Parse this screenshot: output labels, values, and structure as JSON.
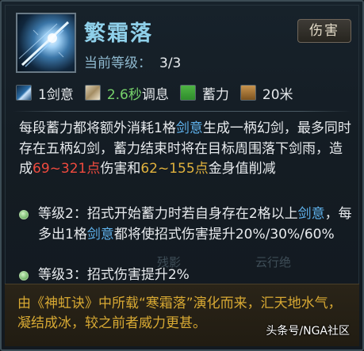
{
  "skill": {
    "name": "繁霜落",
    "level_label": "当前等级：",
    "level_value": "3/3",
    "type_badge": "伤害"
  },
  "stats": {
    "cost": "1剑意",
    "cooldown": "2.6秒",
    "cooldown_suffix": "调息",
    "cast": "蓄力",
    "range": "20米"
  },
  "description": {
    "p1": "每段蓄力都将额外消耗1格",
    "kw1": "剑意",
    "p2": "生成一柄幻剑，最多同时存在五柄幻剑，蓄力结束时将在目标周围落下剑雨，造成",
    "dmg_min": "69",
    "dmg_sep1": "~",
    "dmg_max": "321",
    "dmg_unit": "点",
    "p3": "伤害和",
    "gold_min": "62",
    "gold_sep": "~",
    "gold_max": "155",
    "gold_unit": "点",
    "p4": "金身值削减"
  },
  "levels": {
    "lv2_a": "等级2：招式开始蓄力时若自身存在2格以上",
    "lv2_kw1": "剑意",
    "lv2_b": "，每多出1格",
    "lv2_kw2": "剑意",
    "lv2_c": "都将使招式伤害提升20%/30%/60%",
    "lv3": "等级3：招式伤害提升2%"
  },
  "faint_labels": {
    "left": "残影",
    "right": "云行绝"
  },
  "lore": "由《神虹诀》中所载“寒霜落”演化而来，汇天地水气，凝结成冰，较之前者威力更甚。",
  "watermark": "头条号/NGA社区",
  "colors": {
    "skill_name": "#8fd0ea",
    "keyword_blue": "#5fb2ec",
    "damage_red": "#ef4a3e",
    "gold": "#e1b23d",
    "stat_green": "#77d36b"
  },
  "icons": {
    "skill": "ice-sword-icon",
    "cost": "sword-qi-icon",
    "cooldown": "hourglass-icon",
    "cast": "charge-icon",
    "range": "range-icon",
    "bullet": "level-bullet-icon"
  }
}
